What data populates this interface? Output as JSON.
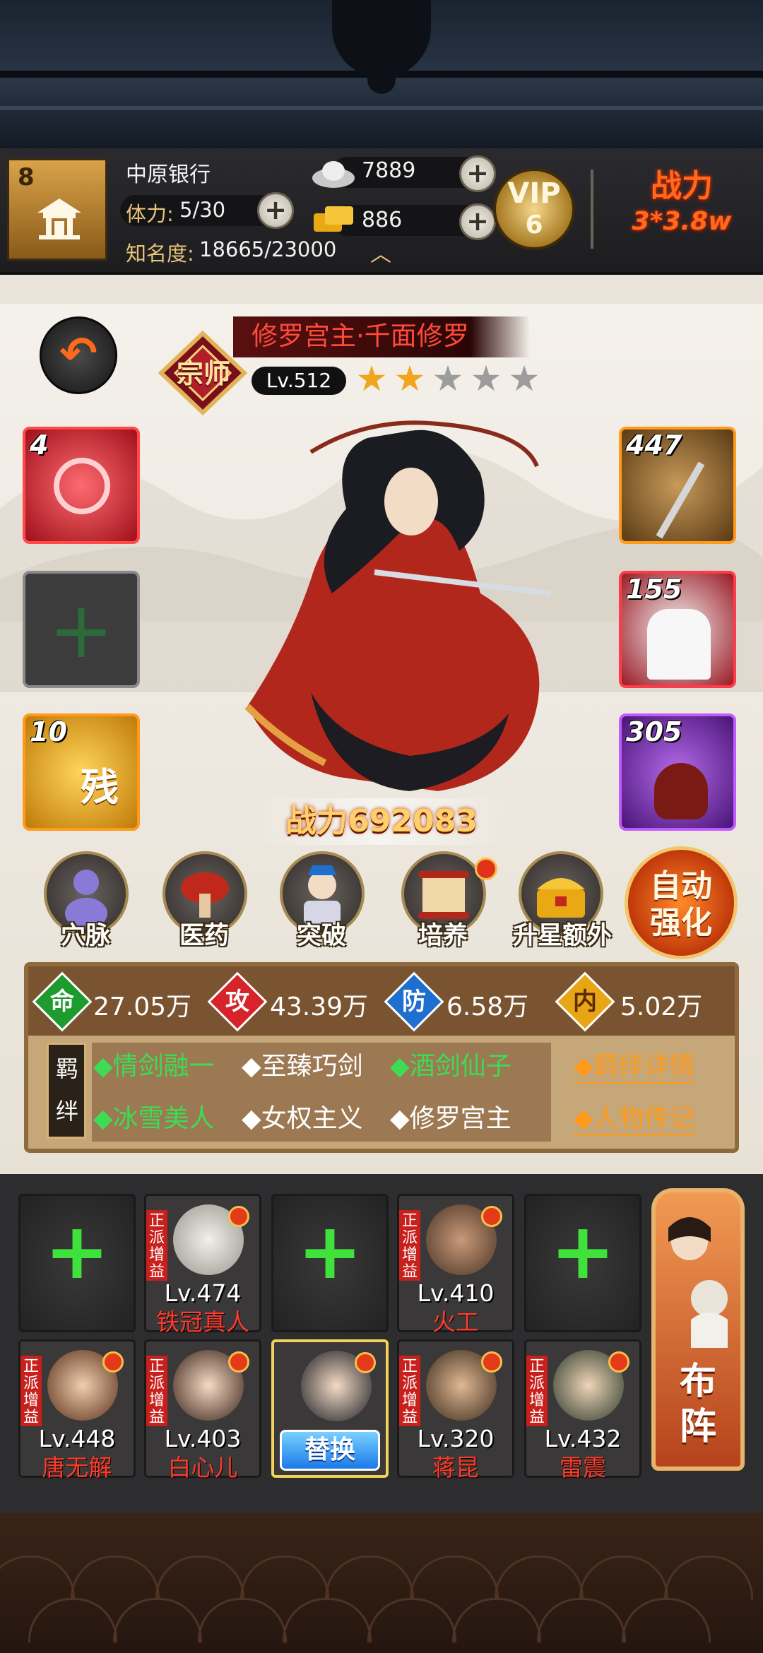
{
  "player": {
    "level": "8",
    "guild": "中原银行",
    "stamina_label": "体力:",
    "stamina_value": "5/30",
    "fame_label": "知名度:",
    "fame_value": "18665/23000"
  },
  "currency": {
    "silver": "7889",
    "gold": "886"
  },
  "vip": {
    "label": "VIP",
    "level": "6"
  },
  "total_power": {
    "label": "战力",
    "value": "3*3.8w"
  },
  "hero": {
    "rank_badge": "宗师",
    "title": "修罗宫主·千面修罗",
    "level": "Lv.512",
    "stars": 2,
    "stars_max": 5,
    "power": "战力692083"
  },
  "equipment": {
    "left": [
      {
        "count": "4",
        "name": "heart-rune",
        "color": "#d6242a"
      },
      {
        "count": "",
        "name": "empty-slot",
        "color": "#3c3c3c"
      },
      {
        "count": "10",
        "name": "gold-manual",
        "color": "#e8a515"
      }
    ],
    "right": [
      {
        "count": "447",
        "name": "blade",
        "color": "#d89a20"
      },
      {
        "count": "155",
        "name": "white-robe",
        "color": "#c0202c"
      },
      {
        "count": "305",
        "name": "wine-pot",
        "color": "#7a2aa8"
      }
    ]
  },
  "functions": [
    {
      "label": "穴脉",
      "badge": false
    },
    {
      "label": "医药",
      "badge": false
    },
    {
      "label": "突破",
      "badge": false
    },
    {
      "label": "培养",
      "badge": true
    },
    {
      "label": "升星额外",
      "badge": false
    }
  ],
  "auto_button": {
    "line1": "自动",
    "line2": "强化"
  },
  "stats": [
    {
      "icon": "命",
      "value": "27.05万",
      "color": "#1e9b2e"
    },
    {
      "icon": "攻",
      "value": "43.39万",
      "color": "#d6242a"
    },
    {
      "icon": "防",
      "value": "6.58万",
      "color": "#1f6fd1"
    },
    {
      "icon": "内",
      "value": "5.02万",
      "color": "#e8a515"
    }
  ],
  "bonds": {
    "tag": "羁绊",
    "items": [
      {
        "label": "◆情剑融一",
        "active": true
      },
      {
        "label": "◆至臻巧剑",
        "active": false
      },
      {
        "label": "◆酒剑仙子",
        "active": true
      },
      {
        "label": "◆冰雪美人",
        "active": true
      },
      {
        "label": "◆女权主义",
        "active": false
      },
      {
        "label": "◆修罗宫主",
        "active": false
      }
    ],
    "link_detail": "◆羁绊详情",
    "link_bio": "◆人物传记"
  },
  "lineup": {
    "tag_text": "正派增益",
    "swap_label": "替换",
    "row1": [
      {
        "empty": true
      },
      {
        "empty": false,
        "level": "Lv.474",
        "name": "铁冠真人"
      },
      {
        "empty": true
      },
      {
        "empty": false,
        "level": "Lv.410",
        "name": "火工"
      },
      {
        "empty": true
      }
    ],
    "row2": [
      {
        "empty": false,
        "level": "Lv.448",
        "name": "唐无解"
      },
      {
        "empty": false,
        "level": "Lv.403",
        "name": "白心儿"
      },
      {
        "empty": false,
        "selected": true
      },
      {
        "empty": false,
        "level": "Lv.320",
        "name": "蒋昆"
      },
      {
        "empty": false,
        "level": "Lv.432",
        "name": "雷震"
      }
    ],
    "formation_label_1": "布",
    "formation_label_2": "阵"
  }
}
